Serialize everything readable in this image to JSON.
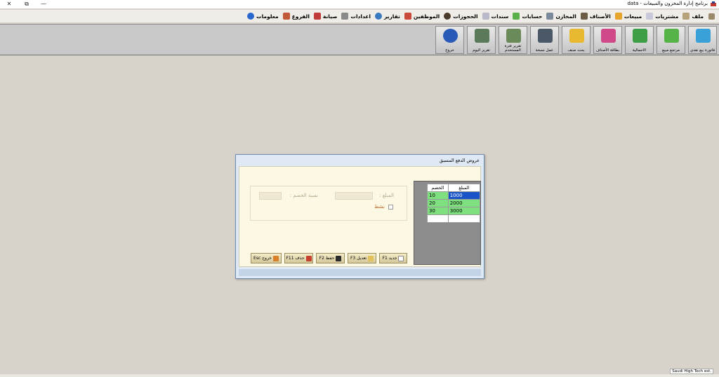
{
  "window": {
    "title": "برنامج إدارة المخزون والمبيعات - data",
    "controls": {
      "close": "✕",
      "restore": "⧉",
      "minimize": "—"
    }
  },
  "menu": {
    "items": [
      {
        "label": "ملف",
        "icon": "file-icon",
        "color": "#b5a27a"
      },
      {
        "label": "مشتريات",
        "icon": "document-icon",
        "color": "#c8c8d8"
      },
      {
        "label": "مبيعات",
        "icon": "sales-icon",
        "color": "#e6a52a"
      },
      {
        "label": "الأصناف",
        "icon": "box-icon",
        "color": "#6b5a45"
      },
      {
        "label": "المخازن",
        "icon": "warehouse-icon",
        "color": "#7a8a9a"
      },
      {
        "label": "حسابات",
        "icon": "accounts-icon",
        "color": "#5bb04a"
      },
      {
        "label": "سندات",
        "icon": "voucher-icon",
        "color": "#b9b9c9"
      },
      {
        "label": "الحجوزات",
        "icon": "reservation-icon",
        "color": "#4a3a2a"
      },
      {
        "label": "الموظفين",
        "icon": "employees-icon",
        "color": "#c94a3a"
      },
      {
        "label": "تقارير",
        "icon": "reports-icon",
        "color": "#3a7ac0"
      },
      {
        "label": "اعدادات",
        "icon": "settings-icon",
        "color": "#8a8a8a"
      },
      {
        "label": "صيانة",
        "icon": "maintenance-icon",
        "color": "#c03a3a"
      },
      {
        "label": "الفروع",
        "icon": "branches-icon",
        "color": "#2a6ad0"
      },
      {
        "label": "معلومات",
        "icon": "info-icon",
        "color": "#ffffff"
      }
    ]
  },
  "toolbar": {
    "buttons": [
      {
        "label": "فاتورة بيع نقدي",
        "icon": "cash-sale-icon",
        "color": "#3aa0d8"
      },
      {
        "label": "مرتجع مبيع",
        "icon": "sales-return-icon",
        "color": "#55b348"
      },
      {
        "label": "الاجمالية",
        "icon": "totals-icon",
        "color": "#3d9e45"
      },
      {
        "label": "بطاقة الأصناف",
        "icon": "items-card-icon",
        "color": "#d04a8a"
      },
      {
        "label": "بحث صنف",
        "icon": "item-search-icon",
        "color": "#e8b830"
      },
      {
        "label": "عمل نسخة",
        "icon": "backup-icon",
        "color": "#4a5868"
      },
      {
        "label": "تقرير فترة المستخدم",
        "icon": "user-report-icon",
        "color": "#6a8a5a"
      },
      {
        "label": "تقرير اليوم",
        "icon": "daily-report-icon",
        "color": "#5a7a5a"
      },
      {
        "label": "خروج",
        "icon": "lock-icon",
        "color": "#2a5ab8"
      }
    ]
  },
  "dialog": {
    "title": "عروض الدفع المسبق",
    "grid": {
      "headers": {
        "amount": "المبلغ",
        "discount": "الخصم"
      },
      "rows": [
        {
          "amount": "1000",
          "discount": "10"
        },
        {
          "amount": "2000",
          "discount": "20"
        },
        {
          "amount": "3000",
          "discount": "30"
        }
      ]
    },
    "form": {
      "amount_label": "المبلغ :",
      "discount_label": "نسبة الخصم :",
      "active_label": "نشط"
    },
    "actions": {
      "new": "جديد F1",
      "edit": "تعديل F3",
      "save": "حفظ F2",
      "delete": "حذف F11",
      "exit": "خروج Esc"
    }
  },
  "status": {
    "company": "Saudi High Tech est."
  }
}
